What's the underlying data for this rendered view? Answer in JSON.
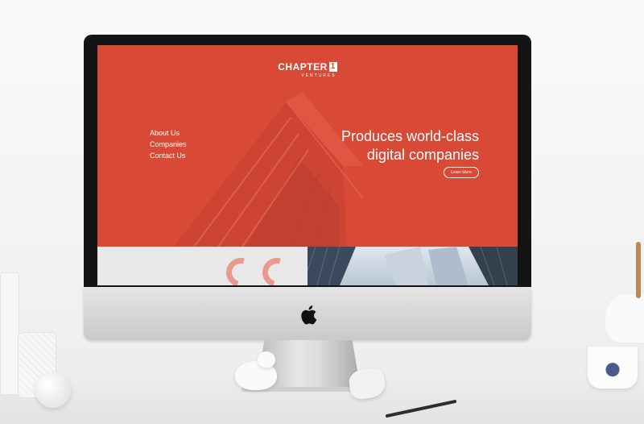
{
  "website": {
    "logo": {
      "main": "CHAPTER",
      "badge": "1",
      "sub": "VENTURES"
    },
    "nav": {
      "items": [
        "About Us",
        "Companies",
        "Contact Us"
      ]
    },
    "hero": {
      "headline_line1": "Produces world-class",
      "headline_line2": "digital companies",
      "cta_label": "Learn More"
    }
  },
  "colors": {
    "brand_red": "#d94a36",
    "quote_accent": "#e89a8c",
    "screen_bezel": "#141414"
  },
  "icons": [
    "apple-logo-icon",
    "quote-icon"
  ]
}
